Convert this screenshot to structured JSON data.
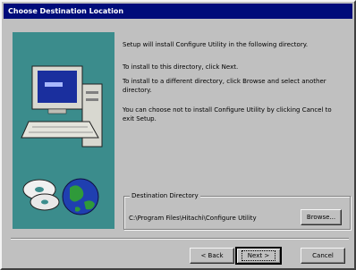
{
  "window": {
    "title": "Choose Destination Location"
  },
  "content": {
    "para1": "Setup will install Configure Utility in the following directory.",
    "para2": "To install to this directory, click Next.",
    "para3": "To install to a different directory, click Browse and select another directory.",
    "para4": "You can choose not to install Configure Utility by clicking Cancel to exit Setup."
  },
  "destination": {
    "group_label": "Destination Directory",
    "path": "C:\\Program Files\\Hitachi\\Configure Utility",
    "browse_label": "Browse..."
  },
  "buttons": {
    "back": "< Back",
    "next": "Next >",
    "cancel": "Cancel"
  },
  "colors": {
    "titlebar": "#000c7a",
    "art_background": "#3b8c8c",
    "dialog": "#c0c0c0"
  }
}
